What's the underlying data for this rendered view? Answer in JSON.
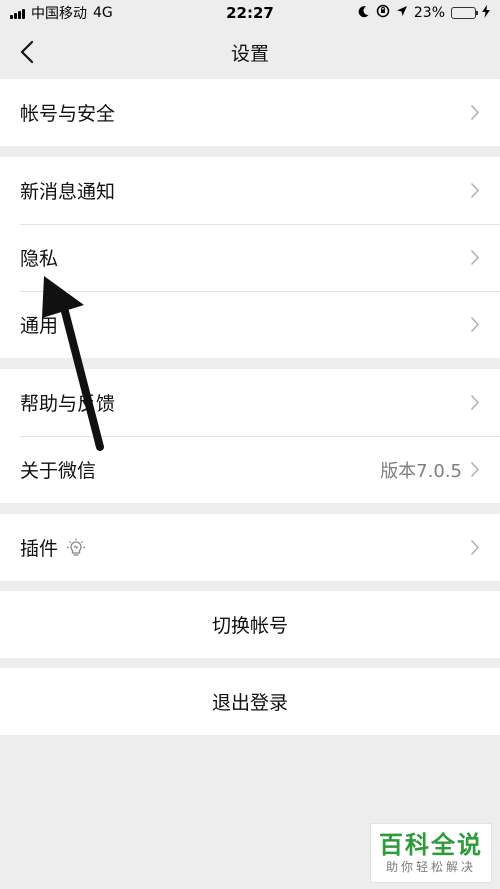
{
  "status_bar": {
    "carrier": "中国移动",
    "network": "4G",
    "time": "22:27",
    "battery_percent": "23%",
    "battery_level": 0.23
  },
  "nav": {
    "title": "设置"
  },
  "groups": {
    "account": [
      {
        "label": "帐号与安全"
      }
    ],
    "general": [
      {
        "label": "新消息通知"
      },
      {
        "label": "隐私"
      },
      {
        "label": "通用"
      }
    ],
    "about": [
      {
        "label": "帮助与反馈"
      },
      {
        "label": "关于微信",
        "value": "版本7.0.5"
      }
    ],
    "plugins": [
      {
        "label": "插件"
      }
    ]
  },
  "actions": {
    "switch_account": "切换帐号",
    "logout": "退出登录"
  },
  "watermark": {
    "title": "百科全说",
    "subtitle": "助你轻松解决"
  },
  "colors": {
    "background": "#ededed",
    "battery_green": "#3bc34a",
    "watermark_green": "#2e9b3a"
  }
}
